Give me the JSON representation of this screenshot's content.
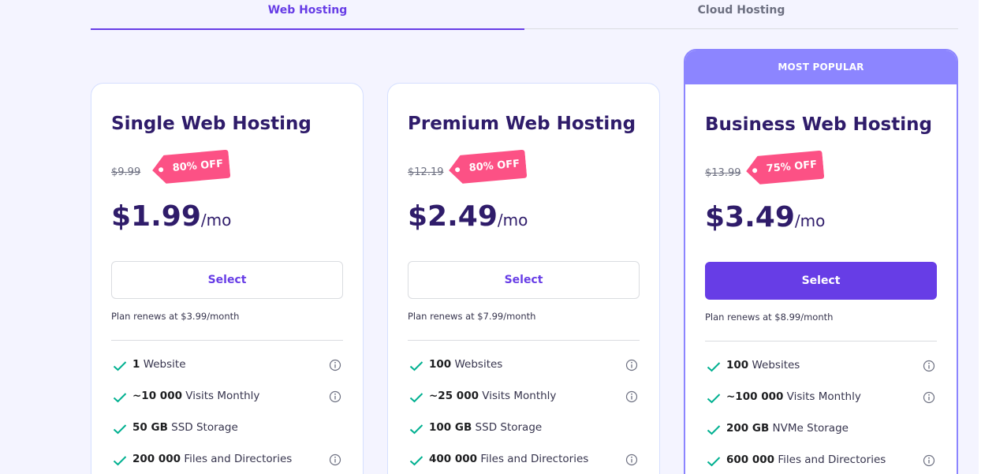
{
  "tabs": [
    {
      "label": "Web Hosting",
      "active": true
    },
    {
      "label": "Cloud Hosting",
      "active": false
    }
  ],
  "colors": {
    "accent": "#673de6",
    "popular": "#8c85ff",
    "discount": "#fc5185",
    "check": "#00b090",
    "title": "#2f1c6a"
  },
  "plans": [
    {
      "title": "Single Web Hosting",
      "old_price": "$9.99",
      "discount": "80% OFF",
      "price": "$1.99",
      "per": "/mo",
      "select_label": "Select",
      "renew": "Plan renews at $3.99/month",
      "features": [
        {
          "bold": "1",
          "text": " Website",
          "info": true
        },
        {
          "bold": "~10 000",
          "text": " Visits Monthly",
          "info": true
        },
        {
          "bold": "50 GB",
          "text": " SSD Storage",
          "info": false
        },
        {
          "bold": "200 000",
          "text": " Files and Directories",
          "info": true
        }
      ]
    },
    {
      "title": "Premium Web Hosting",
      "old_price": "$12.19",
      "discount": "80% OFF",
      "price": "$2.49",
      "per": "/mo",
      "select_label": "Select",
      "renew": "Plan renews at $7.99/month",
      "features": [
        {
          "bold": "100",
          "text": " Websites",
          "info": true
        },
        {
          "bold": "~25 000",
          "text": " Visits Monthly",
          "info": true
        },
        {
          "bold": "100 GB",
          "text": " SSD Storage",
          "info": false
        },
        {
          "bold": "400 000",
          "text": " Files and Directories",
          "info": true
        }
      ]
    },
    {
      "badge": "MOST POPULAR",
      "title": "Business Web Hosting",
      "old_price": "$13.99",
      "discount": "75% OFF",
      "price": "$3.49",
      "per": "/mo",
      "select_label": "Select",
      "renew": "Plan renews at $8.99/month",
      "features": [
        {
          "bold": "100",
          "text": " Websites",
          "info": true
        },
        {
          "bold": "~100 000",
          "text": " Visits Monthly",
          "info": true
        },
        {
          "bold": "200 GB",
          "text": " NVMe Storage",
          "info": false
        },
        {
          "bold": "600 000",
          "text": " Files and Directories",
          "info": true
        }
      ]
    }
  ]
}
